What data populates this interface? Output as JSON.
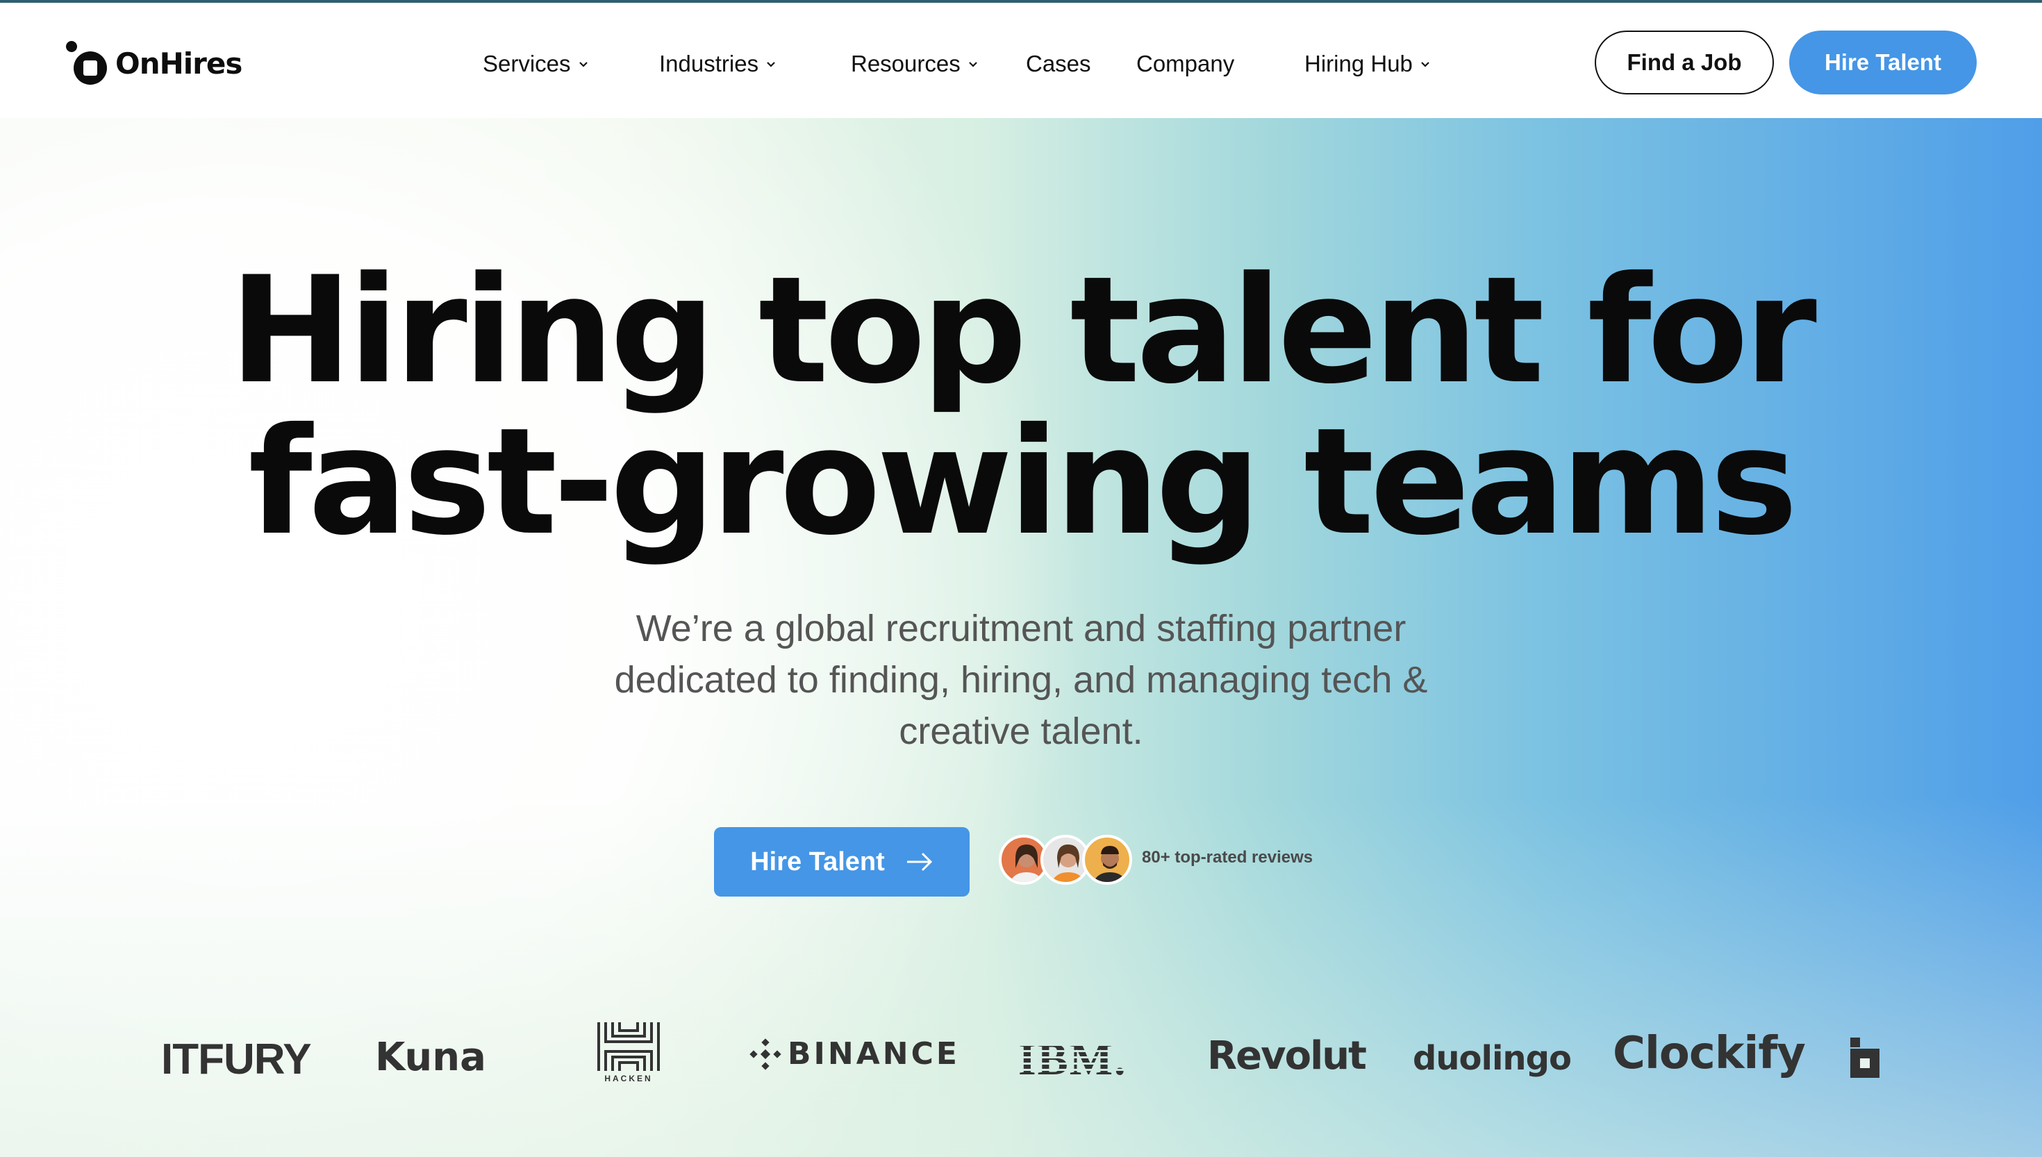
{
  "header": {
    "brand": "OnHires",
    "nav": [
      {
        "label": "Services",
        "dropdown": true
      },
      {
        "label": "Industries",
        "dropdown": true
      },
      {
        "label": "Resources",
        "dropdown": true
      },
      {
        "label": "Cases",
        "dropdown": false
      },
      {
        "label": "Company",
        "dropdown": false
      },
      {
        "label": "Hiring Hub",
        "dropdown": true
      }
    ],
    "find_job_label": "Find a Job",
    "hire_talent_label": "Hire Talent"
  },
  "hero": {
    "headline_line1": "Hiring top talent for",
    "headline_line2": "fast-growing teams",
    "subtitle": "We’re a global recruitment and staffing partner dedicated to finding, hiring, and managing tech & creative talent.",
    "cta_label": "Hire Talent",
    "reviews_text": "80+ top-rated reviews"
  },
  "client_logos": {
    "bitfury": "ITFURY",
    "kuna": "Kuna",
    "hacken": "HACKEN",
    "binance": "BINANCE",
    "ibm": "IBM.",
    "revolut": "Revolut",
    "duolingo": "duolingo",
    "clockify": "Clockify"
  },
  "colors": {
    "accent": "#4596e6",
    "text": "#0d0d0d",
    "muted": "#555555"
  },
  "icons": [
    "onhires-logo-icon",
    "chevron-down-icon",
    "arrow-right-icon",
    "binance-icon",
    "hacken-icon"
  ]
}
